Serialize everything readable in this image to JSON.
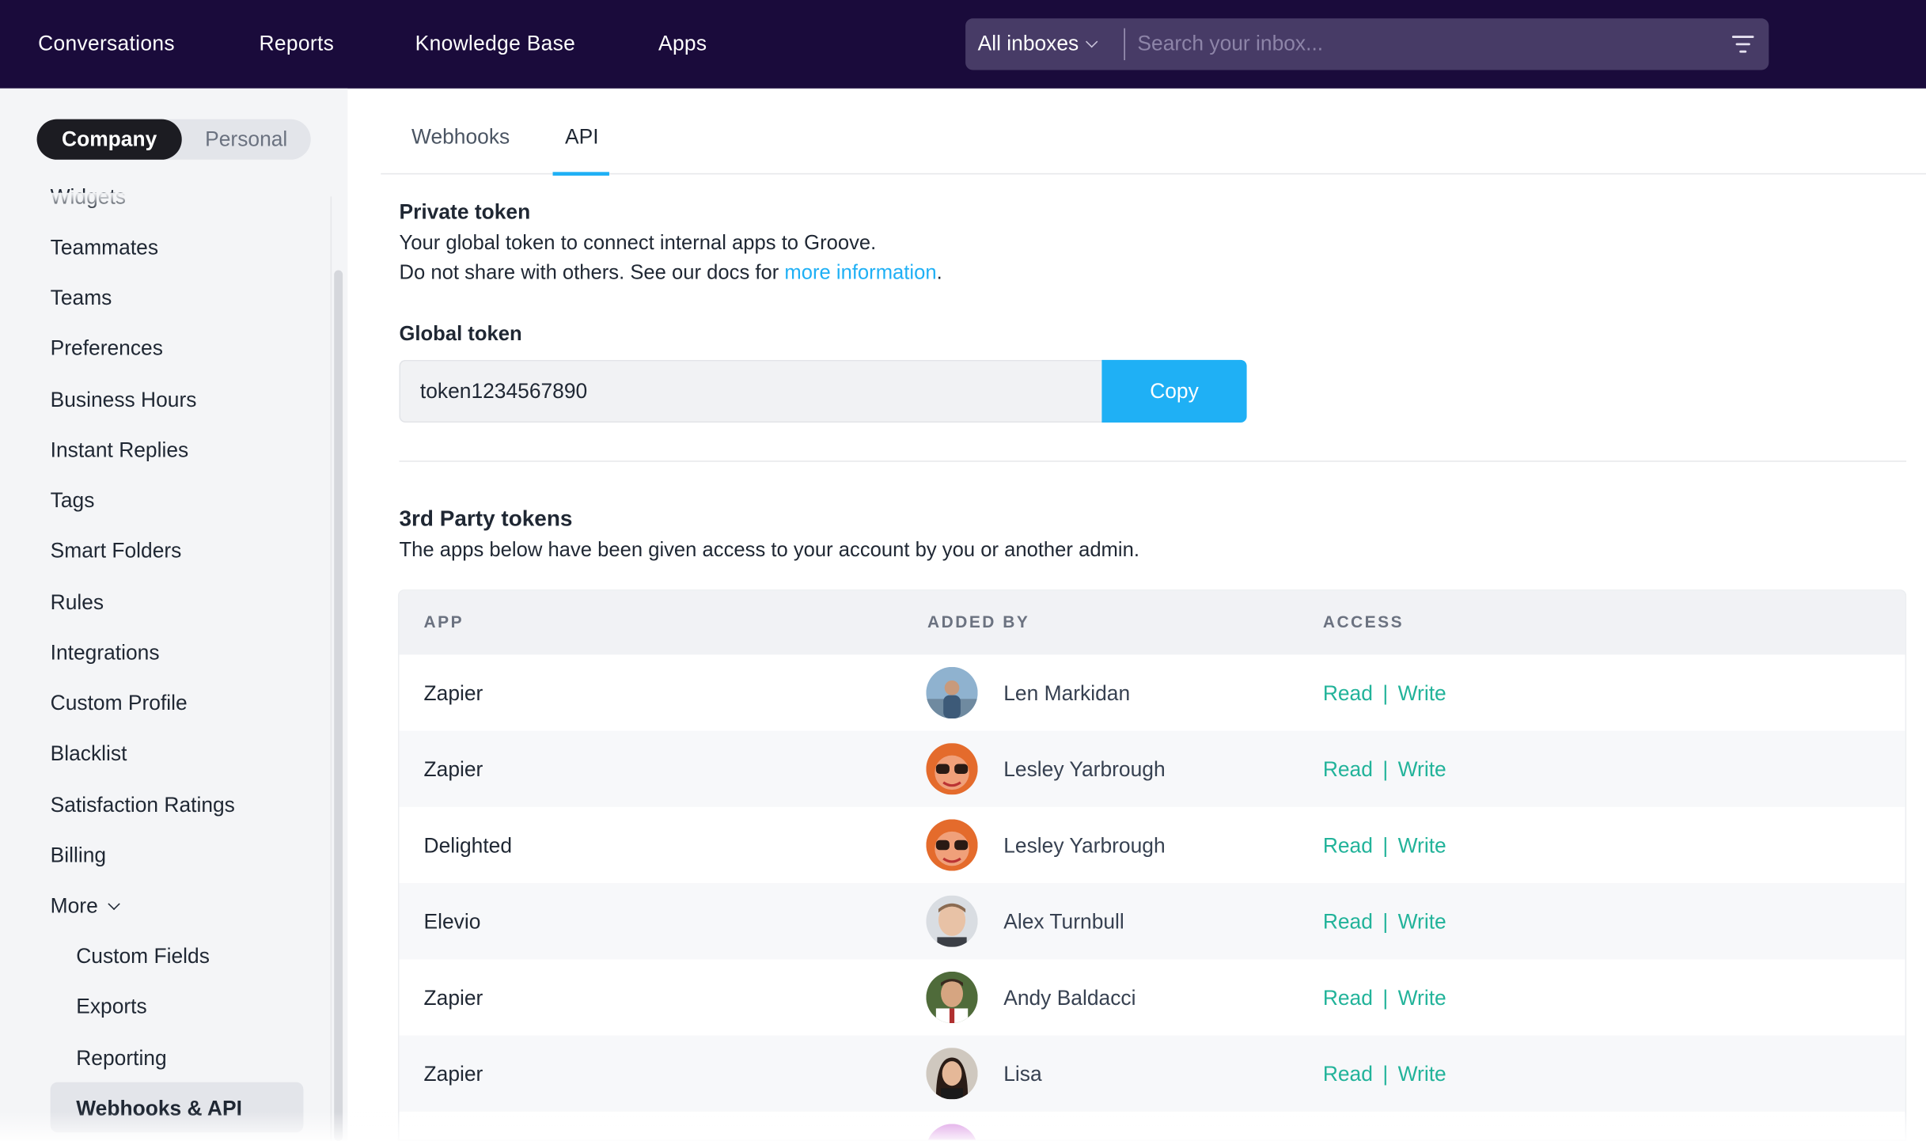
{
  "topnav": {
    "links": [
      "Conversations",
      "Reports",
      "Knowledge Base",
      "Apps"
    ],
    "inbox_select": "All inboxes",
    "search_placeholder": "Search your inbox..."
  },
  "sidebar": {
    "segment": {
      "company": "Company",
      "personal": "Personal"
    },
    "items": [
      "Widgets",
      "Teammates",
      "Teams",
      "Preferences",
      "Business Hours",
      "Instant Replies",
      "Tags",
      "Smart Folders",
      "Rules",
      "Integrations",
      "Custom Profile",
      "Blacklist",
      "Satisfaction Ratings",
      "Billing",
      "More"
    ],
    "sub_items": [
      "Custom Fields",
      "Exports",
      "Reporting",
      "Webhooks & API"
    ]
  },
  "tabs": [
    "Webhooks",
    "API"
  ],
  "private_token": {
    "title": "Private token",
    "line1": "Your global token to connect internal apps to Groove.",
    "line2_prefix": "Do not share with others. See our docs for ",
    "line2_link": "more information",
    "line2_suffix": "."
  },
  "global_token": {
    "label": "Global token",
    "value": "token1234567890",
    "copy_label": "Copy"
  },
  "third_party": {
    "title": "3rd Party tokens",
    "description": "The apps below have been given access to your account by you or another admin.",
    "columns": [
      "APP",
      "ADDED BY",
      "ACCESS"
    ],
    "rows": [
      {
        "app": "Zapier",
        "added_by": "Len Markidan",
        "read": "Read",
        "write": "Write"
      },
      {
        "app": "Zapier",
        "added_by": "Lesley Yarbrough",
        "read": "Read",
        "write": "Write"
      },
      {
        "app": "Delighted",
        "added_by": "Lesley Yarbrough",
        "read": "Read",
        "write": "Write"
      },
      {
        "app": "Elevio",
        "added_by": "Alex Turnbull",
        "read": "Read",
        "write": "Write"
      },
      {
        "app": "Zapier",
        "added_by": "Andy Baldacci",
        "read": "Read",
        "write": "Write"
      },
      {
        "app": "Zapier",
        "added_by": "Lisa",
        "read": "Read",
        "write": "Write"
      }
    ],
    "access_separator": "|"
  },
  "colors": {
    "nav_bg": "#1a0b3b",
    "accent_blue": "#1fb0f5",
    "access_green": "#22b39a"
  }
}
